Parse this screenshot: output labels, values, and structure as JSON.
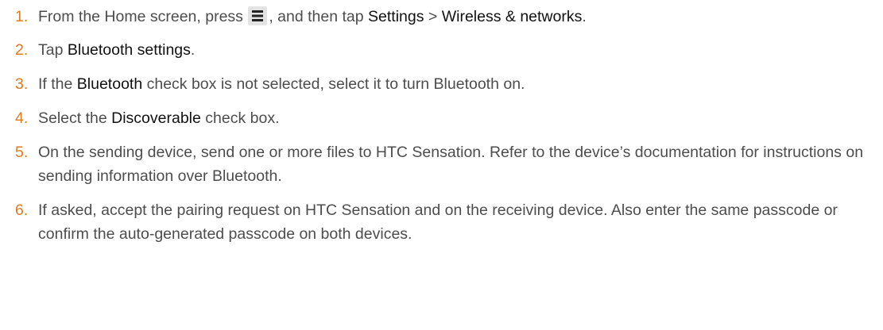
{
  "steps": [
    {
      "num": "1.",
      "t1": "From the Home screen, press ",
      "t2": ", and then tap ",
      "ui1": "Settings",
      "t3": " > ",
      "ui2": "Wireless & networks",
      "t4": "."
    },
    {
      "num": "2.",
      "t1": "Tap ",
      "ui1": "Bluetooth settings",
      "t2": "."
    },
    {
      "num": "3.",
      "t1": "If the ",
      "ui1": "Bluetooth",
      "t2": " check box is not selected, select it to turn Bluetooth on."
    },
    {
      "num": "4.",
      "t1": "Select the ",
      "ui1": "Discoverable",
      "t2": " check box."
    },
    {
      "num": "5.",
      "text": "On the sending device, send one or more files to HTC Sensation. Refer to the device’s documentation for instructions on sending information over Bluetooth."
    },
    {
      "num": "6.",
      "text": "If asked, accept the pairing request on HTC Sensation and on the receiving device. Also enter the same passcode or confirm the auto-generated passcode on both devices."
    }
  ],
  "icons": {
    "menu": "menu-icon"
  },
  "colors": {
    "step_number": "#e07a1f",
    "body_text": "#4d4d4d",
    "ui_text": "#111111"
  }
}
